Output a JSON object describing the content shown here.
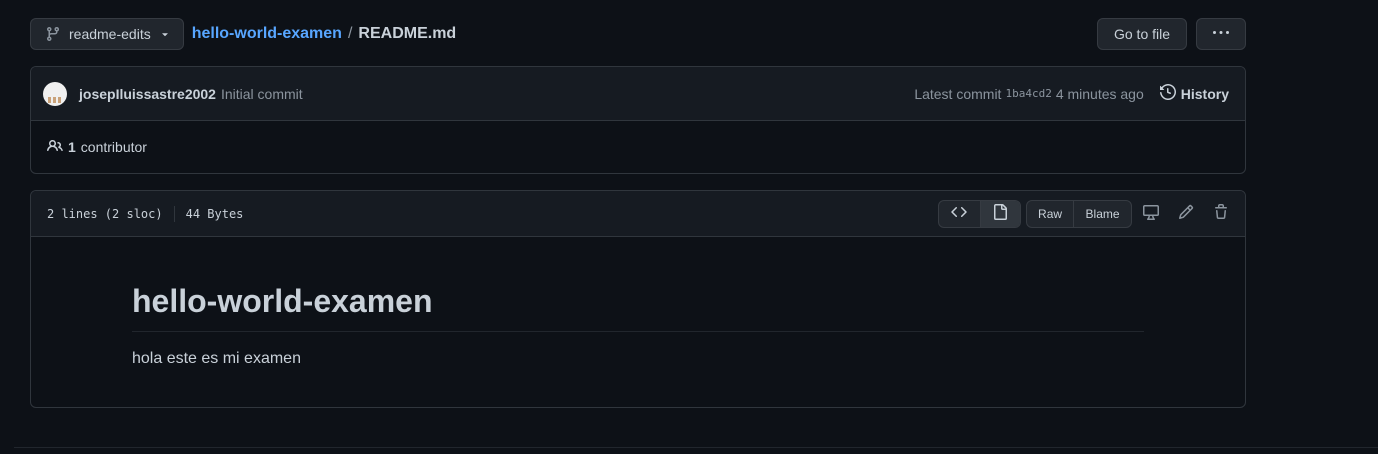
{
  "branch": {
    "name": "readme-edits",
    "icon": "git-branch-icon"
  },
  "breadcrumb": {
    "repo": "hello-world-examen",
    "separator": "/",
    "file": "README.md"
  },
  "actions": {
    "go_to_file": "Go to file",
    "more_icon": "kebab-horizontal-icon"
  },
  "commit": {
    "author": "josepIluissastre2002",
    "message": "Initial commit",
    "latest_label": "Latest commit",
    "sha": "1ba4cd2",
    "time": "4 minutes ago",
    "history_label": "History"
  },
  "contributors": {
    "count": "1",
    "label": "contributor"
  },
  "file": {
    "lines": "2 lines (2 sloc)",
    "size": "44 Bytes",
    "raw_label": "Raw",
    "blame_label": "Blame"
  },
  "readme": {
    "heading": "hello-world-examen",
    "paragraph": "hola este es mi examen"
  },
  "colors": {
    "background": "#0d1117",
    "header_bg": "#161b22",
    "border": "#30363d",
    "link": "#58a6ff",
    "text": "#c9d1d9",
    "muted": "#8b949e"
  }
}
